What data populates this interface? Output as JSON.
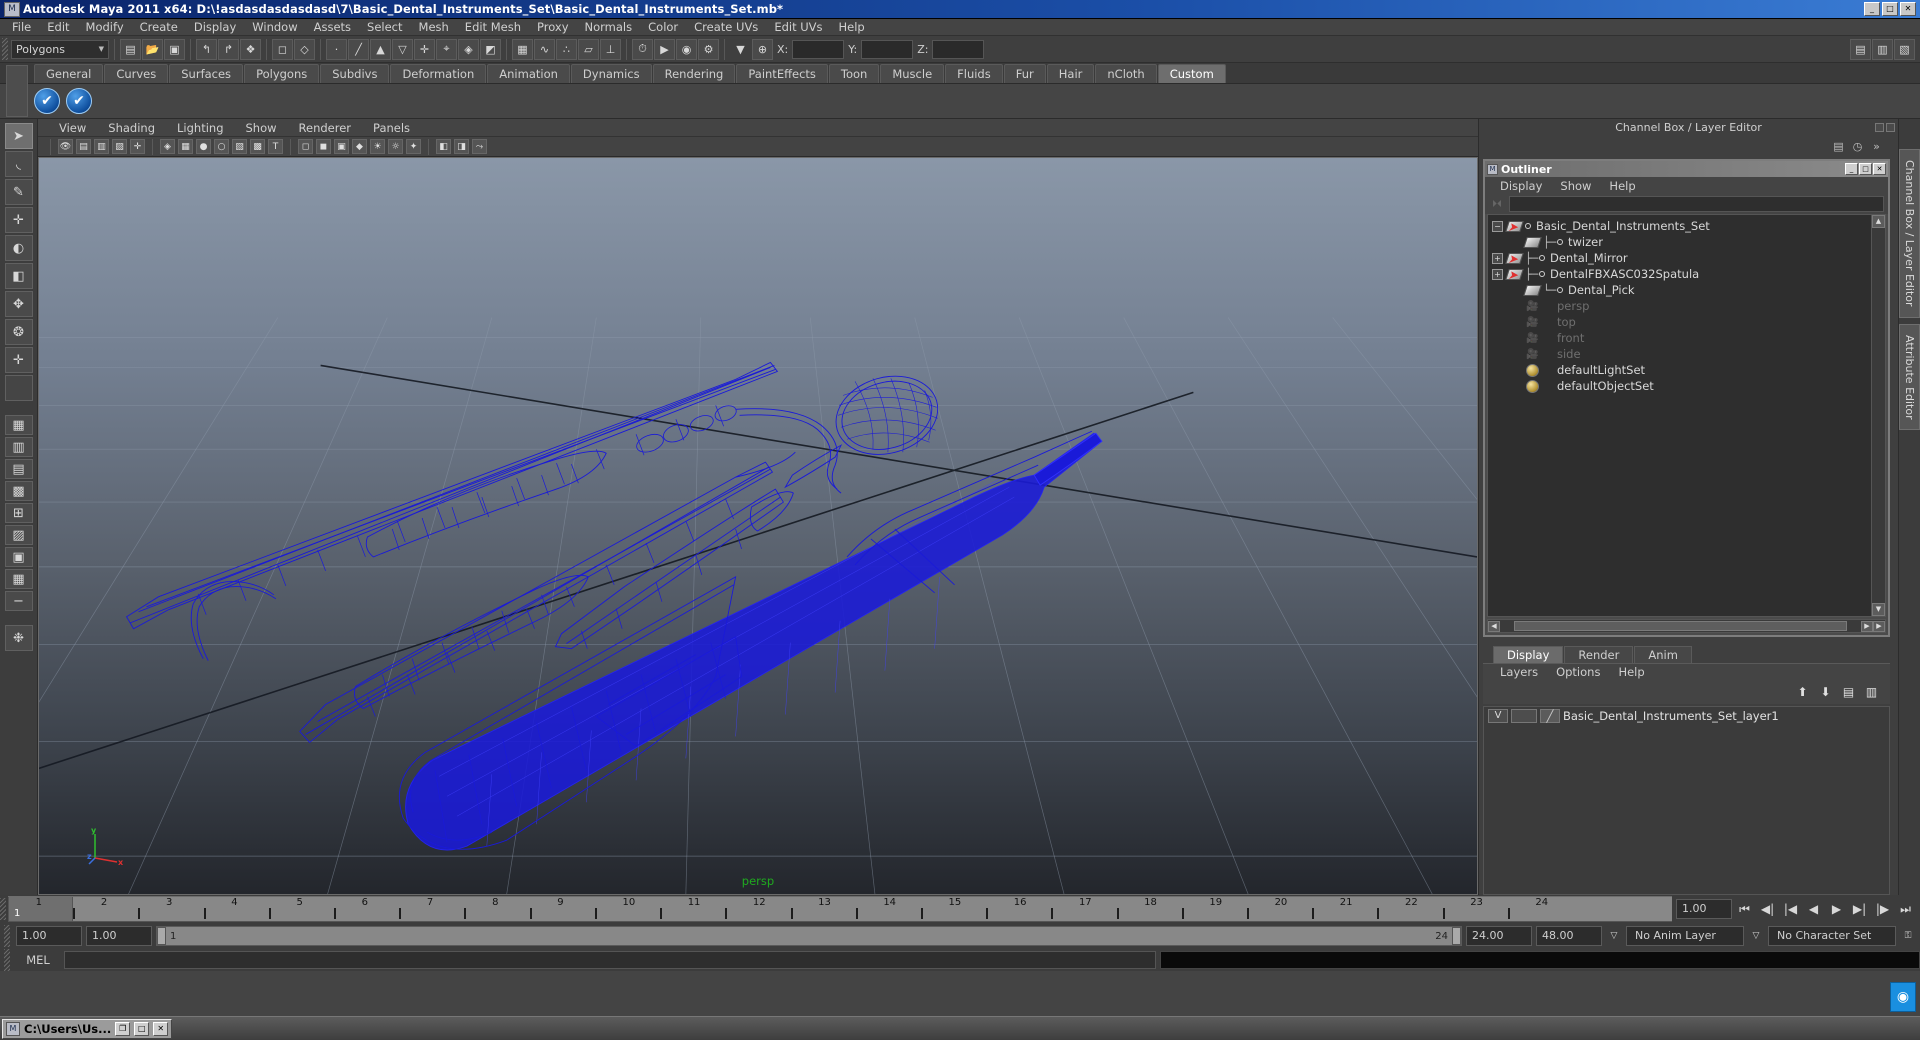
{
  "window": {
    "title": "Autodesk Maya 2011 x64: D:\\!asdasdasdasdasd\\7\\Basic_Dental_Instruments_Set\\Basic_Dental_Instruments_Set.mb*",
    "app_icon": "maya-icon",
    "minimize": "_",
    "maximize": "□",
    "close": "✕"
  },
  "menubar": {
    "items": [
      {
        "label": "File"
      },
      {
        "label": "Edit"
      },
      {
        "label": "Modify"
      },
      {
        "label": "Create"
      },
      {
        "label": "Display"
      },
      {
        "label": "Window"
      },
      {
        "label": "Assets"
      },
      {
        "label": "Select"
      },
      {
        "label": "Mesh"
      },
      {
        "label": "Edit Mesh"
      },
      {
        "label": "Proxy"
      },
      {
        "label": "Normals"
      },
      {
        "label": "Color"
      },
      {
        "label": "Create UVs"
      },
      {
        "label": "Edit UVs"
      },
      {
        "label": "Help"
      }
    ]
  },
  "statusbar": {
    "mode_select": "Polygons",
    "axis_x_label": "X:",
    "axis_y_label": "Y:",
    "axis_z_label": "Z:",
    "axis_x_value": "",
    "axis_y_value": "",
    "axis_z_value": "",
    "icons": [
      "selection-mask-icon",
      "open-scene-icon",
      "save-scene-icon",
      "undo-icon",
      "redo-icon",
      "snap-grid-icon",
      "snap-curve-icon",
      "snap-point-icon",
      "snap-view-plane-icon",
      "snap-normal-icon",
      "construction-history-icon",
      "render-current-frame-icon",
      "ipr-render-icon",
      "render-settings-icon",
      "lock-icon",
      "hypergraph-icon",
      "outliner-panel-icon"
    ]
  },
  "shelf": {
    "tabs": [
      {
        "label": "General",
        "active": false
      },
      {
        "label": "Curves",
        "active": false
      },
      {
        "label": "Surfaces",
        "active": false
      },
      {
        "label": "Polygons",
        "active": false
      },
      {
        "label": "Subdivs",
        "active": false
      },
      {
        "label": "Deformation",
        "active": false
      },
      {
        "label": "Animation",
        "active": false
      },
      {
        "label": "Dynamics",
        "active": false
      },
      {
        "label": "Rendering",
        "active": false
      },
      {
        "label": "PaintEffects",
        "active": false
      },
      {
        "label": "Toon",
        "active": false
      },
      {
        "label": "Muscle",
        "active": false
      },
      {
        "label": "Fluids",
        "active": false
      },
      {
        "label": "Fur",
        "active": false
      },
      {
        "label": "Hair",
        "active": false
      },
      {
        "label": "nCloth",
        "active": false
      },
      {
        "label": "Custom",
        "active": true
      }
    ],
    "buttons": [
      {
        "name": "shelf-item-1",
        "glyph": "✔"
      },
      {
        "name": "shelf-item-2",
        "glyph": "✔"
      }
    ]
  },
  "toolbox": {
    "tools": [
      {
        "name": "select-tool",
        "glyph": "➤",
        "active": true
      },
      {
        "name": "lasso-select-tool",
        "glyph": "◟"
      },
      {
        "name": "paint-select-tool",
        "glyph": "✎"
      },
      {
        "name": "move-tool",
        "glyph": "✛"
      },
      {
        "name": "rotate-tool",
        "glyph": "◐"
      },
      {
        "name": "scale-tool",
        "glyph": "◧"
      },
      {
        "name": "universal-manipulator-tool",
        "glyph": "✥"
      },
      {
        "name": "soft-modification-tool",
        "glyph": "❂"
      },
      {
        "name": "show-manipulator-tool",
        "glyph": "✛"
      },
      {
        "name": "last-tool-used",
        "glyph": ""
      },
      {
        "name": "layout-single-pane",
        "glyph": "▦"
      },
      {
        "name": "layout-two-pane-side",
        "glyph": "▥"
      },
      {
        "name": "layout-two-pane-stacked",
        "glyph": "▤"
      },
      {
        "name": "layout-three-pane",
        "glyph": "▩"
      },
      {
        "name": "layout-four-pane",
        "glyph": "⊞"
      },
      {
        "name": "layout-hypergraph",
        "glyph": "▨"
      },
      {
        "name": "layout-outliner-persp",
        "glyph": "▣"
      },
      {
        "name": "layout-graph-editor",
        "glyph": "▦"
      },
      {
        "name": "layout-more",
        "glyph": "−"
      },
      {
        "name": "paint-effects-toggle",
        "glyph": "❉"
      }
    ]
  },
  "viewport": {
    "menus": [
      {
        "label": "View"
      },
      {
        "label": "Shading"
      },
      {
        "label": "Lighting"
      },
      {
        "label": "Show"
      },
      {
        "label": "Renderer"
      },
      {
        "label": "Panels"
      }
    ],
    "toolbar_icons": [
      "select-camera-icon",
      "camera-attributes-icon",
      "bookmarks-icon",
      "image-plane-icon",
      "twopoint-resolution-icon",
      "wireframe-icon",
      "smooth-shade-all-icon",
      "smooth-shade-selected-icon",
      "flat-shade-icon",
      "shaded-wireframe-icon",
      "textured-icon",
      "use-lights-icon",
      "shadows-icon",
      "xray-icon",
      "xray-joints-icon",
      "isolate-select-icon",
      "hi-quality-render-icon",
      "no-lights-icon",
      "default-lights-icon",
      "all-lights-icon",
      "exposure-icon",
      "gamma-icon"
    ],
    "camera_label": "persp",
    "axis_labels": {
      "x": "x",
      "y": "y",
      "z": "z"
    },
    "model_color": "#1a1ad8",
    "grid_color": "#8d99aa",
    "background_top": "#8a97a8",
    "background_bottom": "#23262c"
  },
  "channel_box_header": "Channel Box / Layer Editor",
  "outliner": {
    "title": "Outliner",
    "window_buttons": {
      "minimize": "_",
      "maximize": "□",
      "close": "✕"
    },
    "menus": [
      {
        "label": "Display"
      },
      {
        "label": "Show"
      },
      {
        "label": "Help"
      }
    ],
    "search_value": "",
    "items": [
      {
        "label": "Basic_Dental_Instruments_Set",
        "indent": 0,
        "expander": "−",
        "icon": "transform-icon",
        "dim": false,
        "connector": false
      },
      {
        "label": "twizer",
        "indent": 1,
        "expander": "",
        "icon": "mesh-icon",
        "dim": false,
        "connector": true
      },
      {
        "label": "Dental_Mirror",
        "indent": 1,
        "expander": "+",
        "icon": "transform-icon",
        "dim": false,
        "connector": true
      },
      {
        "label": "DentalFBXASC032Spatula",
        "indent": 1,
        "expander": "+",
        "icon": "transform-icon",
        "dim": false,
        "connector": true
      },
      {
        "label": "Dental_Pick",
        "indent": 1,
        "expander": "",
        "icon": "mesh-icon",
        "dim": false,
        "connector": true
      },
      {
        "label": "persp",
        "indent": 1,
        "expander": "",
        "icon": "camera-icon",
        "dim": true,
        "connector": false
      },
      {
        "label": "top",
        "indent": 1,
        "expander": "",
        "icon": "camera-icon",
        "dim": true,
        "connector": false
      },
      {
        "label": "front",
        "indent": 1,
        "expander": "",
        "icon": "camera-icon",
        "dim": true,
        "connector": false
      },
      {
        "label": "side",
        "indent": 1,
        "expander": "",
        "icon": "camera-icon",
        "dim": true,
        "connector": false
      },
      {
        "label": "defaultLightSet",
        "indent": 1,
        "expander": "",
        "icon": "set-icon",
        "dim": false,
        "connector": false
      },
      {
        "label": "defaultObjectSet",
        "indent": 1,
        "expander": "",
        "icon": "set-icon",
        "dim": false,
        "connector": false
      }
    ]
  },
  "layer_editor": {
    "tabs": [
      {
        "label": "Display",
        "active": true
      },
      {
        "label": "Render",
        "active": false
      },
      {
        "label": "Anim",
        "active": false
      }
    ],
    "menus": [
      {
        "label": "Layers"
      },
      {
        "label": "Options"
      },
      {
        "label": "Help"
      }
    ],
    "icons": [
      "move-layer-up-icon",
      "move-layer-down-icon",
      "new-layer-icon",
      "new-layer-from-selected-icon"
    ],
    "layers": [
      {
        "visibility": "V",
        "playback": "",
        "name": "Basic_Dental_Instruments_Set_layer1"
      }
    ]
  },
  "side_tabs": [
    {
      "label": "Channel Box / Layer Editor",
      "active": true
    },
    {
      "label": "Attribute Editor",
      "active": false
    }
  ],
  "timeline": {
    "ticks": [
      "1",
      "2",
      "3",
      "4",
      "5",
      "6",
      "7",
      "8",
      "9",
      "10",
      "11",
      "12",
      "13",
      "14",
      "15",
      "16",
      "17",
      "18",
      "19",
      "20",
      "21",
      "22",
      "23",
      "24"
    ],
    "current_frame_label": "1",
    "current_frame_field": "1.00",
    "playback_buttons": [
      "go-to-start-icon",
      "step-back-frame-icon",
      "step-back-key-icon",
      "play-backwards-icon",
      "play-forwards-icon",
      "step-forward-key-icon",
      "step-forward-frame-icon",
      "go-to-end-icon"
    ]
  },
  "range": {
    "start_field": "1.00",
    "end_field": "1.00",
    "range_start_label": "1",
    "range_end_label": "24",
    "anim_start": "24.00",
    "anim_end": "48.00",
    "anim_layer": "No Anim Layer",
    "character_set": "No Character Set",
    "key-icon": "key-icon"
  },
  "command_line": {
    "language_label": "MEL",
    "input_value": "",
    "output_value": ""
  },
  "taskbar": {
    "items": [
      {
        "label": "C:\\Users\\Us...",
        "icon": "maya-icon",
        "buttons": {
          "restore": "❐",
          "maximize": "□",
          "close": "✕"
        }
      }
    ]
  }
}
